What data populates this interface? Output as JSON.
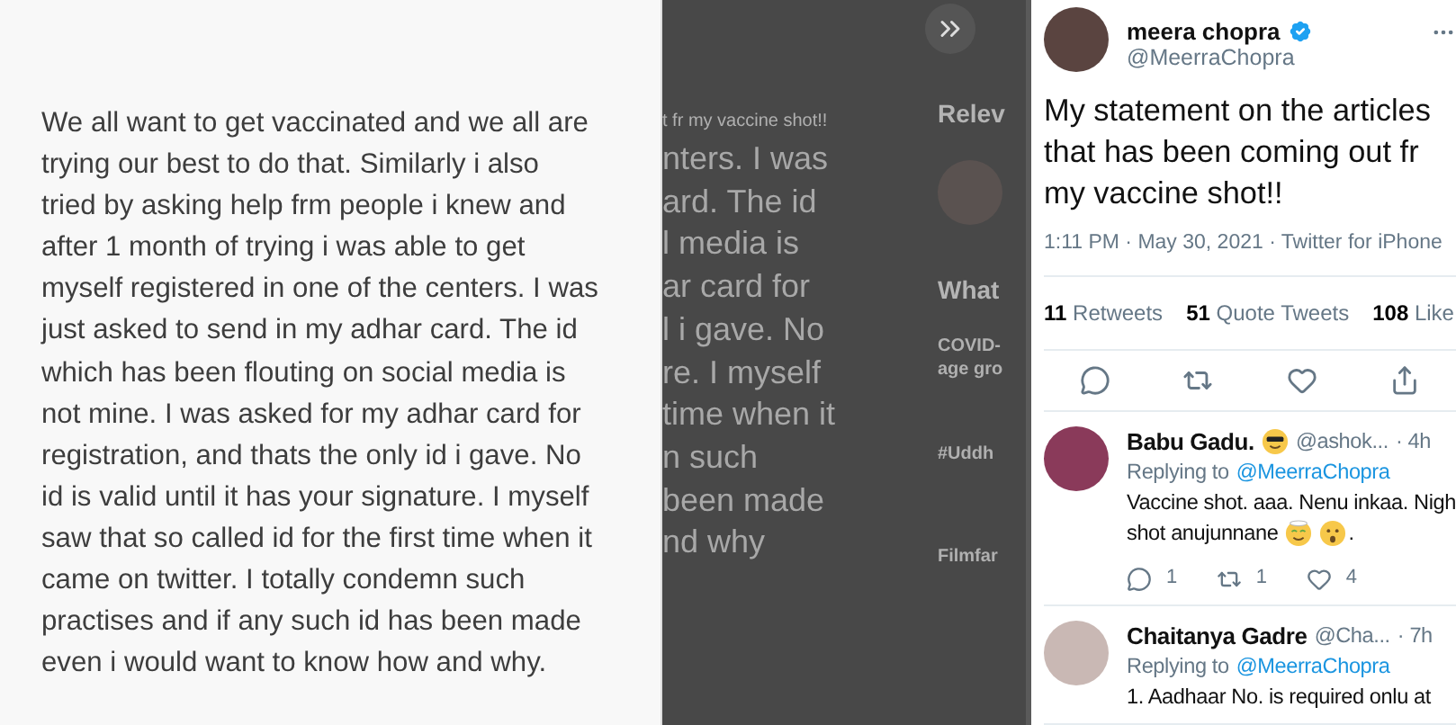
{
  "statement": {
    "lines": [
      "We all want to get vaccinated and we all are",
      "trying our best to do that. Similarly i also",
      "tried by asking help frm people i knew and",
      "after 1 month of trying i was able to get",
      "myself registered in one of the centers. I was",
      "just asked to send in my adhar card. The id",
      "which has been flouting on social media is",
      "not mine. I was asked for my adhar card for",
      "registration, and thats the only id i gave. No",
      "id is valid until it has your signature. I myself",
      "saw that so called id for the first time when it",
      "came on twitter. I totally condemn such",
      "practises and if any such id has been made",
      "even i would want to know how and why."
    ]
  },
  "background_page": {
    "caption": "t fr my vaccine shot!!",
    "fragments": [
      "nters. I was",
      "ard. The id",
      "l media is",
      "ar card for",
      "l i gave. No",
      "re. I myself",
      "time when it",
      "n such",
      "been made",
      "nd why"
    ],
    "sidebar": [
      {
        "kind": "heading",
        "text": "Relev"
      },
      {
        "kind": "avatar"
      },
      {
        "kind": "heading",
        "text": "What"
      },
      {
        "kind": "topic",
        "text": "COVID-"
      },
      {
        "kind": "topic",
        "text": "age gro"
      },
      {
        "kind": "topic",
        "text": "#Uddh"
      },
      {
        "kind": "topic",
        "text": "Filmfar"
      }
    ]
  },
  "tweet": {
    "name": "meera chopra",
    "verified": true,
    "handle": "@MeerraChopra",
    "text": "My statement on the articles that has been coming out fr my vaccine shot!!",
    "meta": "1:11 PM · May 30, 2021 · Twitter for iPhone",
    "stats": [
      {
        "count": "11",
        "label": "Retweets"
      },
      {
        "count": "51",
        "label": "Quote Tweets"
      },
      {
        "count": "108",
        "label": "Like"
      }
    ]
  },
  "replies": [
    {
      "name": "Babu Gadu.",
      "name_has_emoji": true,
      "handle": "@ashok...",
      "time": "· 4h",
      "replying_to": "Replying to",
      "mention": "@MeerraChopra",
      "lines": [
        "Vaccine shot. aaa. Nenu inkaa. Nigh",
        "shot anujunnane"
      ],
      "ends_with_emojis": true,
      "end_text": ".",
      "counts": [
        "1",
        "1",
        "4"
      ]
    },
    {
      "name": "Chaitanya Gadre",
      "handle": "@Cha...",
      "time": "· 7h",
      "replying_to": "Replying to",
      "mention": "@MeerraChopra",
      "lines": [
        "1. Aadhaar No. is required onlu at"
      ]
    }
  ]
}
